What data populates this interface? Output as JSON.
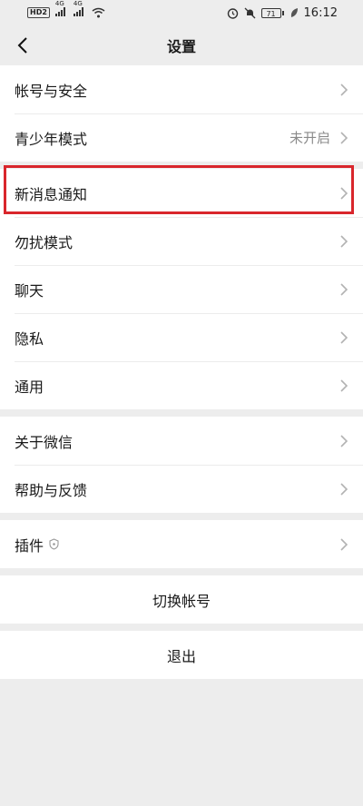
{
  "status": {
    "hd": "HD",
    "hd2": "2",
    "net1": "4G",
    "net2": "4G",
    "battery": "71",
    "time": "16:12"
  },
  "header": {
    "title": "设置"
  },
  "groups": [
    {
      "items": [
        {
          "label": "帐号与安全",
          "value": ""
        },
        {
          "label": "青少年模式",
          "value": "未开启"
        }
      ]
    },
    {
      "items": [
        {
          "label": "新消息通知",
          "value": ""
        },
        {
          "label": "勿扰模式",
          "value": ""
        },
        {
          "label": "聊天",
          "value": ""
        },
        {
          "label": "隐私",
          "value": ""
        },
        {
          "label": "通用",
          "value": ""
        }
      ]
    },
    {
      "items": [
        {
          "label": "关于微信",
          "value": ""
        },
        {
          "label": "帮助与反馈",
          "value": ""
        }
      ]
    },
    {
      "items": [
        {
          "label": "插件",
          "value": ""
        }
      ]
    }
  ],
  "actions": {
    "switch_account": "切换帐号",
    "logout": "退出"
  },
  "colors": {
    "highlight": "#d9262c",
    "background": "#ededed"
  }
}
